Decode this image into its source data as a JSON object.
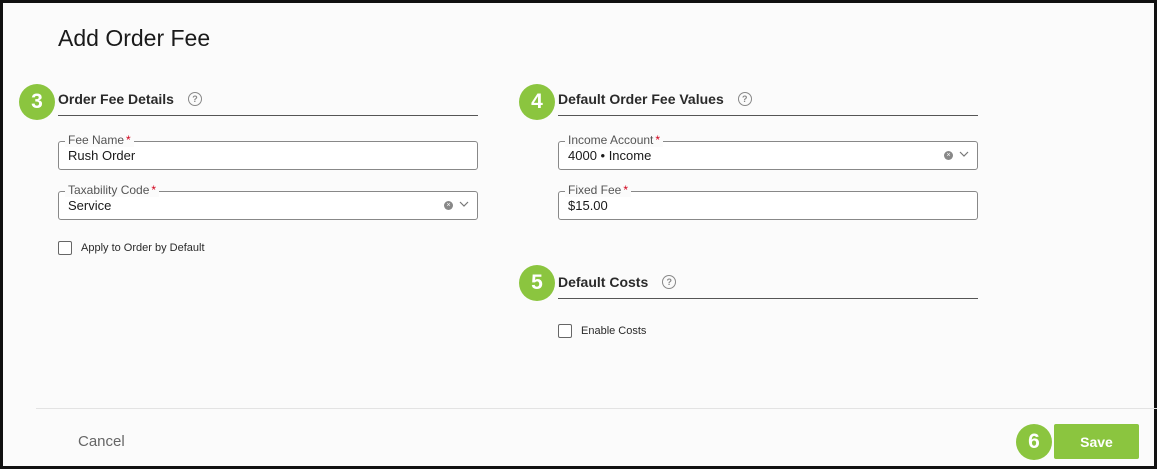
{
  "dialog": {
    "title": "Add Order Fee"
  },
  "steps": {
    "order_fee_details": "3",
    "default_values": "4",
    "default_costs": "5",
    "save": "6"
  },
  "order_fee_details": {
    "title": "Order Fee Details",
    "fee_name": {
      "label": "Fee Name",
      "required": "*",
      "value": "Rush Order"
    },
    "taxability_code": {
      "label": "Taxability Code",
      "required": "*",
      "value": "Service"
    },
    "apply_default": {
      "label": "Apply to Order by Default",
      "checked": false
    }
  },
  "default_values": {
    "title": "Default Order Fee Values",
    "income_account": {
      "label": "Income Account",
      "required": "*",
      "value": "4000 • Income"
    },
    "fixed_fee": {
      "label": "Fixed Fee",
      "required": "*",
      "value": "$15.00"
    }
  },
  "default_costs": {
    "title": "Default Costs",
    "enable_costs": {
      "label": "Enable Costs",
      "checked": false
    }
  },
  "footer": {
    "cancel_label": "Cancel",
    "save_label": "Save"
  },
  "colors": {
    "accent": "#8bc53f",
    "required": "#d0021b"
  },
  "icons": {
    "help": "?",
    "clear": "×"
  }
}
